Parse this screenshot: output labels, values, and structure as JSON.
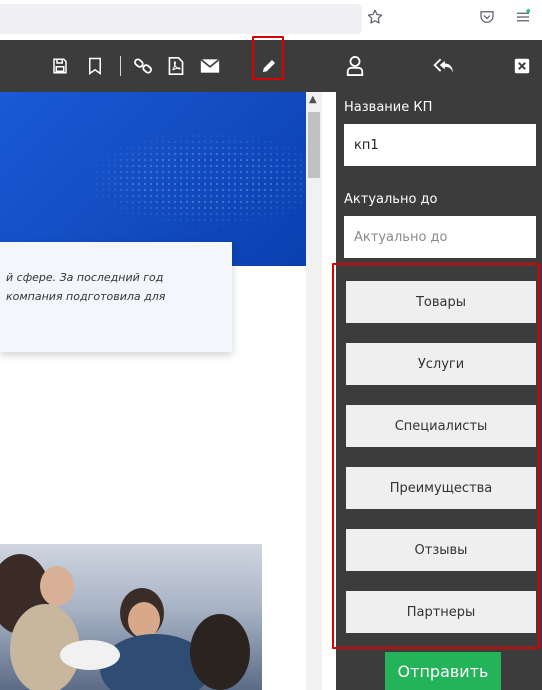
{
  "browser": {
    "star_icon": "star-outline-icon",
    "pocket_icon": "pocket-icon",
    "menu_icon": "hamburger-menu-icon"
  },
  "toolbar": {
    "icons": [
      "save-icon",
      "bookmark-icon",
      "link-icon",
      "pdf-icon",
      "mail-icon",
      "edit-pencil-icon",
      "user-icon",
      "reply-all-icon",
      "close-icon"
    ],
    "highlight_color": "#d90000"
  },
  "content": {
    "card_line1": "й сфере. За последний год",
    "card_line2": "компания подготовила для"
  },
  "panel": {
    "title_label": "Название КП",
    "title_value": "кп1",
    "date_label": "Актуально до",
    "date_placeholder": "Актуально до",
    "sections": [
      "Товары",
      "Услуги",
      "Специалисты",
      "Преимущества",
      "Отзывы",
      "Партнеры"
    ],
    "submit_label": "Отправить",
    "submit_color": "#25b35a"
  }
}
